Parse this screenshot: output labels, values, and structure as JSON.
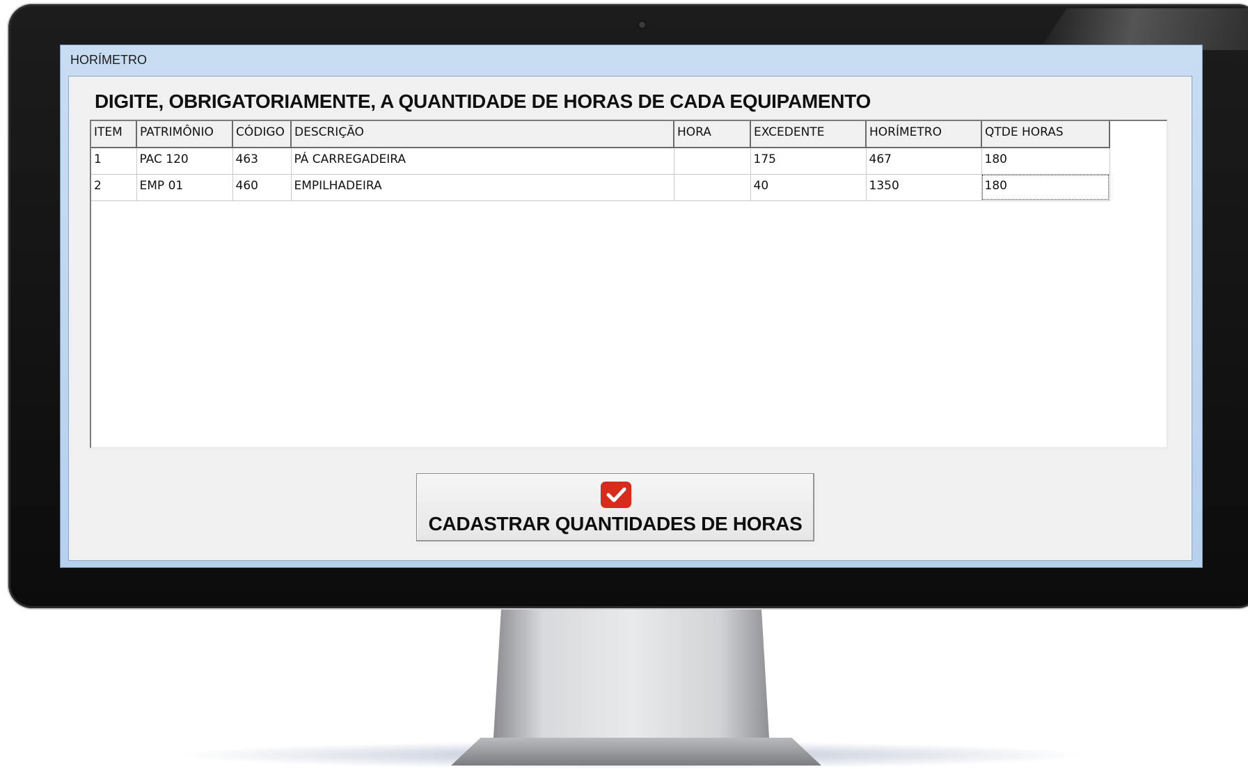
{
  "window": {
    "title": "HORÍMETRO"
  },
  "instruction": "DIGITE, OBRIGATORIAMENTE, A QUANTIDADE DE HORAS DE CADA EQUIPAMENTO",
  "grid": {
    "columns": [
      "ITEM",
      "PATRIMÔNIO",
      "CÓDIGO",
      "DESCRIÇÃO",
      "HORA",
      "EXCEDENTE",
      "HORÍMETRO",
      "QTDE HORAS"
    ],
    "rows": [
      [
        "1",
        "PAC 120",
        "463",
        "PÁ CARREGADEIRA",
        "",
        "175",
        "467",
        "180"
      ],
      [
        "2",
        "EMP 01",
        "460",
        "EMPILHADEIRA",
        "",
        "40",
        "1350",
        "180"
      ]
    ]
  },
  "action_button": {
    "label": "CADASTRAR QUANTIDADES DE HORAS",
    "icon": "red-checkbox-icon",
    "icon_color": "#d82b1b"
  }
}
